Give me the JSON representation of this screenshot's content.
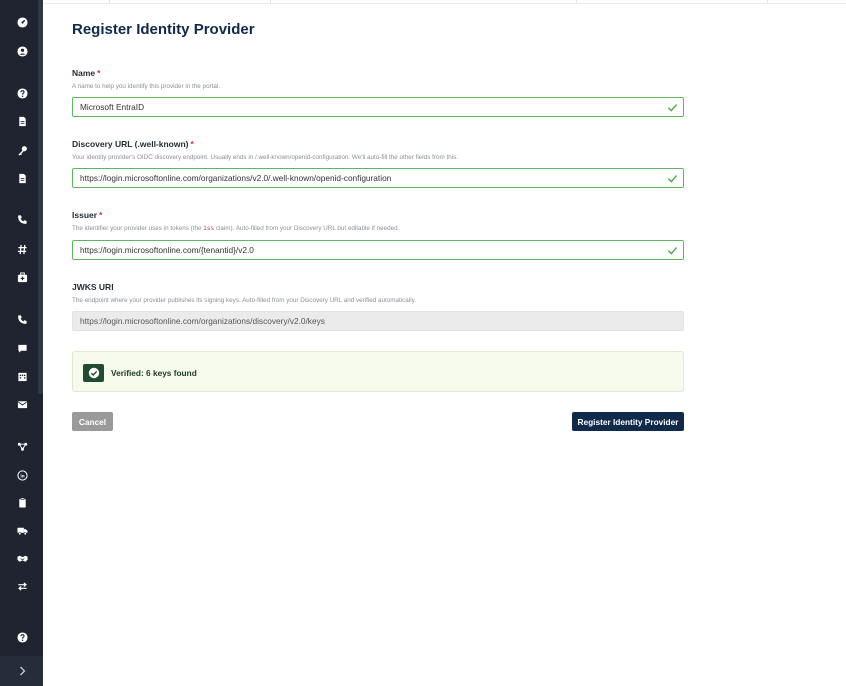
{
  "sidebar": {
    "icons": [
      {
        "name": "dashboard-icon"
      },
      {
        "name": "user-icon"
      },
      {
        "name": "help-circle-icon"
      },
      {
        "name": "document-icon"
      },
      {
        "name": "key-icon"
      },
      {
        "name": "file-icon"
      },
      {
        "name": "phone-icon"
      },
      {
        "name": "hash-icon"
      },
      {
        "name": "medical-box-icon"
      },
      {
        "name": "phone-call-icon"
      },
      {
        "name": "chat-icon"
      },
      {
        "name": "building-icon"
      },
      {
        "name": "mail-icon"
      },
      {
        "name": "network-icon"
      },
      {
        "name": "linkedin-icon"
      },
      {
        "name": "clipboard-icon"
      },
      {
        "name": "truck-icon"
      },
      {
        "name": "handshake-icon"
      },
      {
        "name": "exchange-icon"
      },
      {
        "name": "question-icon"
      }
    ],
    "expand_icon": "chevron-right-icon"
  },
  "page": {
    "title": "Register Identity Provider"
  },
  "form": {
    "name": {
      "label": "Name",
      "required_mark": "*",
      "help": "A name to help you identify this provider in the portal.",
      "value": "Microsoft EntraID"
    },
    "discovery": {
      "label": "Discovery URL (.well-known)",
      "required_mark": "*",
      "help": "Your identity provider's OIDC discovery endpoint. Usually ends in /.well-known/openid-configuration. We'll auto-fill the other fields from this.",
      "value": "https://login.microsoftonline.com/organizations/v2.0/.well-known/openid-configuration"
    },
    "issuer": {
      "label": "Issuer",
      "required_mark": "*",
      "help_before": "The identifier your provider uses in tokens (the ",
      "help_code": "iss",
      "help_after": " claim). Auto-filled from your Discovery URL but editable if needed.",
      "value": "https://login.microsoftonline.com/{tenantid}/v2.0"
    },
    "jwks": {
      "label": "JWKS URI",
      "help": "The endpoint where your provider publishes its signing keys. Auto-filled from your Discovery URL and verified automatically.",
      "value": "https://login.microsoftonline.com/organizations/discovery/v2.0/keys"
    }
  },
  "verification": {
    "text": "Verified: 6 keys found",
    "color": "#1f4d2e"
  },
  "buttons": {
    "cancel": "Cancel",
    "submit": "Register Identity Provider"
  },
  "colors": {
    "sidebar": "#1f2430",
    "primary": "#0f2a4a",
    "valid_border": "#5cb85c",
    "required": "#d9263b"
  }
}
